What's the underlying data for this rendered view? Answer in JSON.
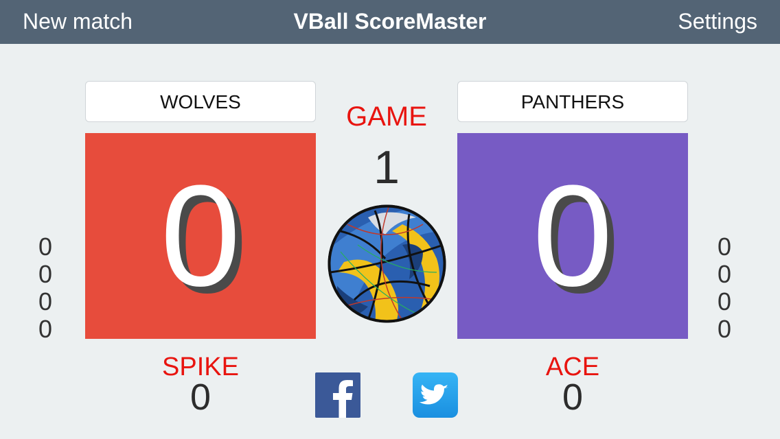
{
  "nav": {
    "left_label": "New match",
    "title": "VBall ScoreMaster",
    "right_label": "Settings"
  },
  "teams": {
    "left": {
      "name": "WOLVES",
      "score": "0",
      "color": "#e74c3c",
      "sets": [
        "0",
        "0",
        "0",
        "0"
      ],
      "stat_label": "SPIKE",
      "stat_value": "0"
    },
    "right": {
      "name": "PANTHERS",
      "score": "0",
      "color": "#775bc4",
      "sets": [
        "0",
        "0",
        "0",
        "0"
      ],
      "stat_label": "ACE",
      "stat_value": "0"
    }
  },
  "game": {
    "label": "GAME",
    "number": "1"
  },
  "icons": {
    "ball": "volleyball-icon",
    "facebook": "facebook-icon",
    "twitter": "twitter-icon"
  }
}
